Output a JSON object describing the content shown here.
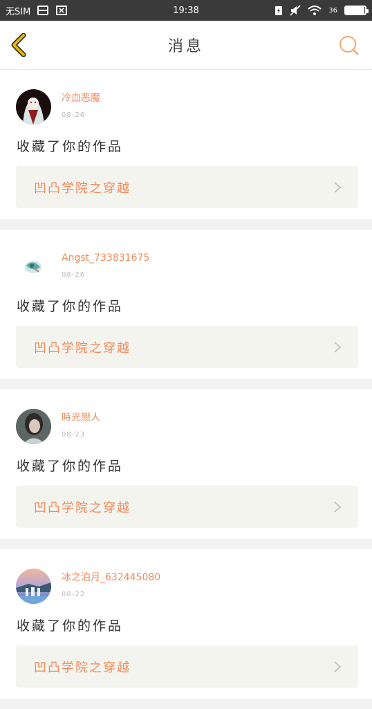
{
  "status_bar": {
    "carrier": "无SIM",
    "time": "19:38",
    "battery_level": 0.95,
    "network": "36"
  },
  "header": {
    "title": "消息"
  },
  "messages": [
    {
      "username": "冷血恶魔",
      "date": "08-26",
      "action": "收藏了你的作品",
      "work_title": "凹凸学院之穿越"
    },
    {
      "username": "Angst_733831675",
      "date": "08-26",
      "action": "收藏了你的作品",
      "work_title": "凹凸学院之穿越"
    },
    {
      "username": "時光戀人",
      "date": "08-23",
      "action": "收藏了你的作品",
      "work_title": "凹凸学院之穿越"
    },
    {
      "username": "冰之泊月_632445080",
      "date": "08-22",
      "action": "收藏了你的作品",
      "work_title": "凹凸学院之穿越"
    }
  ],
  "colors": {
    "accent": "#f08a5a",
    "back_icon": "#e6b600",
    "search_icon": "#f5a56a"
  }
}
